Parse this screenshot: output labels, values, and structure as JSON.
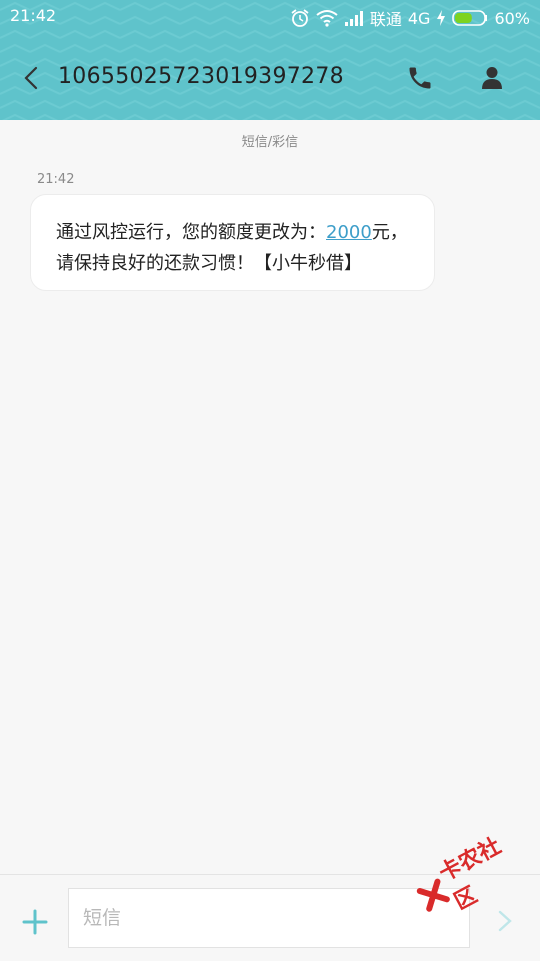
{
  "status_bar": {
    "time": "21:42",
    "carrier": "联通",
    "network": "4G",
    "battery": "60%",
    "battery_level": 0.6
  },
  "header": {
    "phone_number": "10655025723019397278"
  },
  "conversation": {
    "channel_label": "短信/彩信",
    "messages": [
      {
        "time": "21:42",
        "line1_prefix": "通过风控运行，您的额度更改为：",
        "amount": "2000",
        "line1_suffix": "元，",
        "line2": "请保持良好的还款习惯！【小牛秒借】"
      }
    ]
  },
  "composer": {
    "placeholder": "短信"
  },
  "watermark": {
    "text": "卡农社区"
  },
  "colors": {
    "header_bg": "#5fc3cb",
    "accent": "#5fc3cb",
    "link": "#3d9ec9",
    "watermark": "#d92b2b"
  },
  "icons": [
    "alarm-icon",
    "wifi-icon",
    "signal-icon",
    "charging-icon",
    "battery-icon",
    "back-icon",
    "phone-icon",
    "contact-icon",
    "plus-icon",
    "send-icon"
  ]
}
